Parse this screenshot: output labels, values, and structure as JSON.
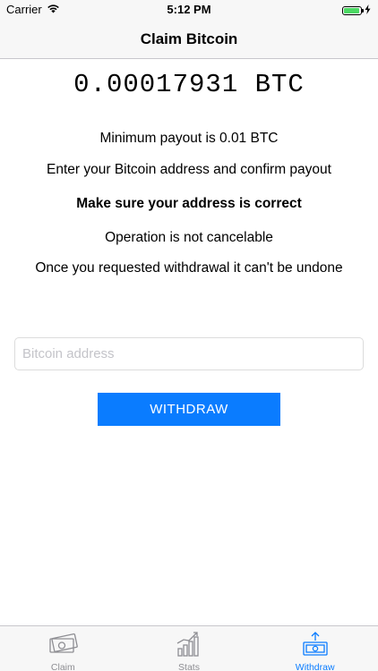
{
  "status_bar": {
    "carrier": "Carrier",
    "time": "5:12 PM",
    "wifi_icon": "wifi-icon",
    "battery_icon": "battery-icon",
    "charging_icon": "bolt-icon"
  },
  "nav": {
    "title": "Claim Bitcoin"
  },
  "balance": "0.00017931 BTC",
  "info": {
    "min_payout": "Minimum payout is 0.01 BTC",
    "enter_address": "Enter your Bitcoin address and confirm payout",
    "warning": "Make sure your address is correct",
    "not_cancelable": "Operation is not cancelable",
    "undone": "Once you requested withdrawal it can't be undone"
  },
  "address_input": {
    "placeholder": "Bitcoin address",
    "value": ""
  },
  "withdraw_button": {
    "label": "WITHDRAW"
  },
  "tabs": [
    {
      "label": "Claim",
      "icon": "money-icon",
      "active": false
    },
    {
      "label": "Stats",
      "icon": "chart-icon",
      "active": false
    },
    {
      "label": "Withdraw",
      "icon": "withdraw-icon",
      "active": true
    }
  ],
  "colors": {
    "accent": "#0a7cff",
    "inactive_tab": "#8e8e93",
    "bar_background": "#f7f7f7",
    "battery_green": "#4cd964"
  }
}
